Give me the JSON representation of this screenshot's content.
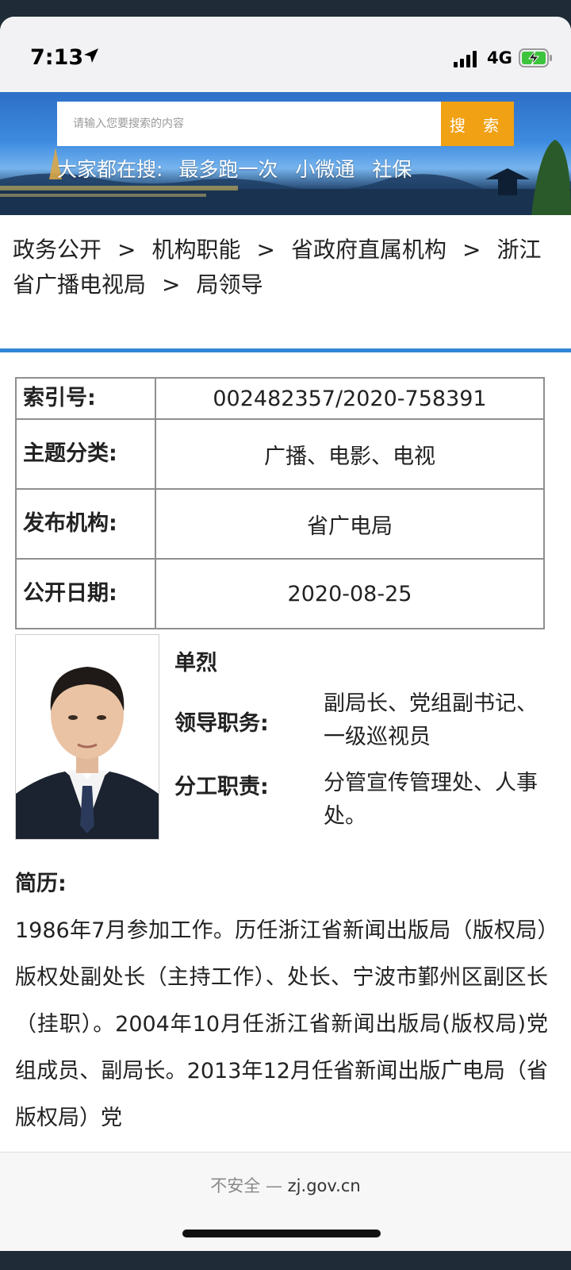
{
  "status_bar": {
    "time": "7:13",
    "network": "4G",
    "icons": [
      "location-arrow-icon",
      "signal-icon",
      "battery-charging-icon"
    ]
  },
  "search": {
    "placeholder": "请输入您要搜索的内容",
    "button_label": "搜 索",
    "hot_label": "大家都在搜:",
    "hot_items": [
      "最多跑一次",
      "小微通",
      "社保"
    ]
  },
  "breadcrumb": {
    "items": [
      "政务公开",
      "机构职能",
      "省政府直属机构",
      "浙江省广播电视局",
      "局领导"
    ],
    "separator": ">"
  },
  "meta": {
    "index_label": "索引号:",
    "index_value": "002482357/2020-758391",
    "topic_label": "主题分类:",
    "topic_value": "广播、电影、电视",
    "org_label": "发布机构:",
    "org_value": "省广电局",
    "date_label": "公开日期:",
    "date_value": "2020-08-25"
  },
  "leader": {
    "name": "单烈",
    "role_label": "领导职务:",
    "role_value": "副局长、党组副书记、一级巡视员",
    "duty_label": "分工职责:",
    "duty_value": "分管宣传管理处、人事处。"
  },
  "resume": {
    "label": "简历:",
    "text": "1986年7月参加工作。历任浙江省新闻出版局（版权局）版权处副处长（主持工作）、处长、宁波市鄞州区副区长（挂职）。2004年10月任浙江省新闻出版局(版权局)党组成员、副局长。2013年12月任省新闻出版广电局（省版权局）党"
  },
  "browser": {
    "insecure_label": "不安全 —",
    "domain": "zj.gov.cn"
  },
  "colors": {
    "accent_blue": "#2f86d6",
    "search_button": "#f1a114",
    "table_border": "#8f8f8f"
  }
}
